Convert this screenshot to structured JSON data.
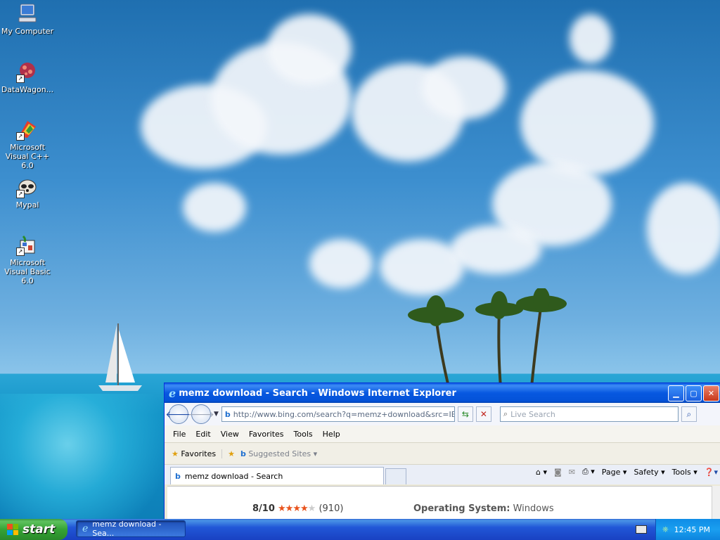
{
  "desktop": {
    "icons": [
      {
        "label": "My Computer"
      },
      {
        "label": "DataWagon..."
      },
      {
        "label": "Microsoft Visual C++ 6.0"
      },
      {
        "label": "Mypal"
      },
      {
        "label": "Microsoft Visual Basic 6.0"
      }
    ]
  },
  "ie": {
    "title": "memz download - Search - Windows Internet Explorer",
    "address": "http://www.bing.com/search?q=memz+download&src=IE-Sear",
    "search_placeholder": "Live Search",
    "menu": [
      "File",
      "Edit",
      "View",
      "Favorites",
      "Tools",
      "Help"
    ],
    "favorites_label": "Favorites",
    "suggested_sites_label": "Suggested Sites ▾",
    "tab_label": "memz download - Search",
    "command_bar": {
      "page": "Page ▾",
      "safety": "Safety ▾",
      "tools": "Tools ▾"
    },
    "content": {
      "rating": "8/10",
      "stars": "★★★★",
      "stars_empty": "★",
      "review_count": "(910)",
      "os_label": "Operating System:",
      "os_value": "Windows"
    }
  },
  "taskbar": {
    "start_label": "start",
    "task_label": "memz download - Sea...",
    "clock": "12:45 PM"
  },
  "colors": {
    "taskbar": "#2157d7",
    "start": "#35a335",
    "title_bar": "#0758e0",
    "star": "#e8531d"
  }
}
